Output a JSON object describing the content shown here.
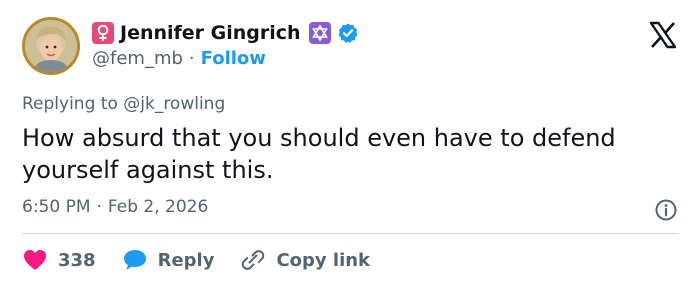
{
  "author": {
    "display_name": "Jennifer Gingrich",
    "handle": "@fem_mb",
    "separator": "·",
    "follow_label": "Follow",
    "name_emoji_icon": "female-sign-icon",
    "name_emoji_trailing_icon": "star-of-david-icon",
    "verified_icon": "verified-badge-icon"
  },
  "reply_context": {
    "prefix": "Replying to",
    "mention": "@jk_rowling"
  },
  "tweet": {
    "text": "How absurd that you should even have to defend yourself against this.",
    "time": "6:50 PM",
    "separator": "·",
    "date": "Feb 2, 2026"
  },
  "actions": {
    "like_count": "338",
    "reply_label": "Reply",
    "copy_link_label": "Copy link"
  },
  "icons": {
    "platform_logo": "x-logo-icon",
    "info": "info-icon",
    "like": "heart-icon",
    "reply": "speech-bubble-icon",
    "copy_link": "link-icon"
  },
  "colors": {
    "accent": "#1d9bf0",
    "like": "#f91880",
    "text": "#0f1419",
    "secondary_text": "#536471",
    "divider": "#cfd9de"
  }
}
